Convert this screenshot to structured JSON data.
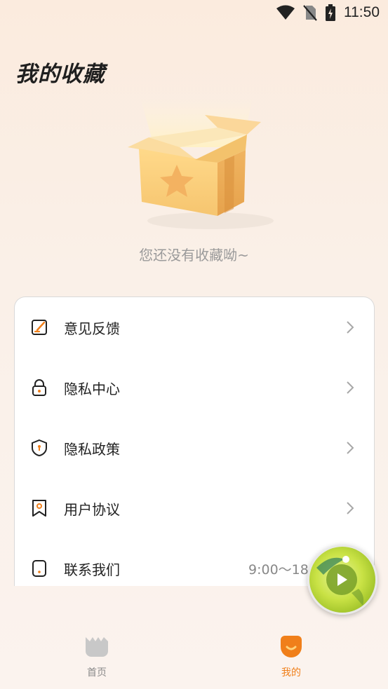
{
  "status_bar": {
    "time": "11:50",
    "icons": [
      "wifi-icon",
      "no-sim-icon",
      "battery-charging-icon"
    ]
  },
  "page": {
    "title": "我的收藏",
    "empty_text": "您还没有收藏呦~"
  },
  "menu": {
    "items": [
      {
        "label": "意见反馈",
        "icon": "feedback-icon"
      },
      {
        "label": "隐私中心",
        "icon": "lock-icon"
      },
      {
        "label": "隐私政策",
        "icon": "shield-icon"
      },
      {
        "label": "用户协议",
        "icon": "bookmark-icon"
      },
      {
        "label": "联系我们",
        "icon": "phone-icon",
        "right_text": "9:00～18:00"
      }
    ]
  },
  "tabs": [
    {
      "label": "首页",
      "icon": "home-icon",
      "active": false
    },
    {
      "label": "我的",
      "icon": "mine-icon",
      "active": true
    }
  ],
  "colors": {
    "accent": "#f07f1a",
    "inactive": "#8a8a8a"
  }
}
